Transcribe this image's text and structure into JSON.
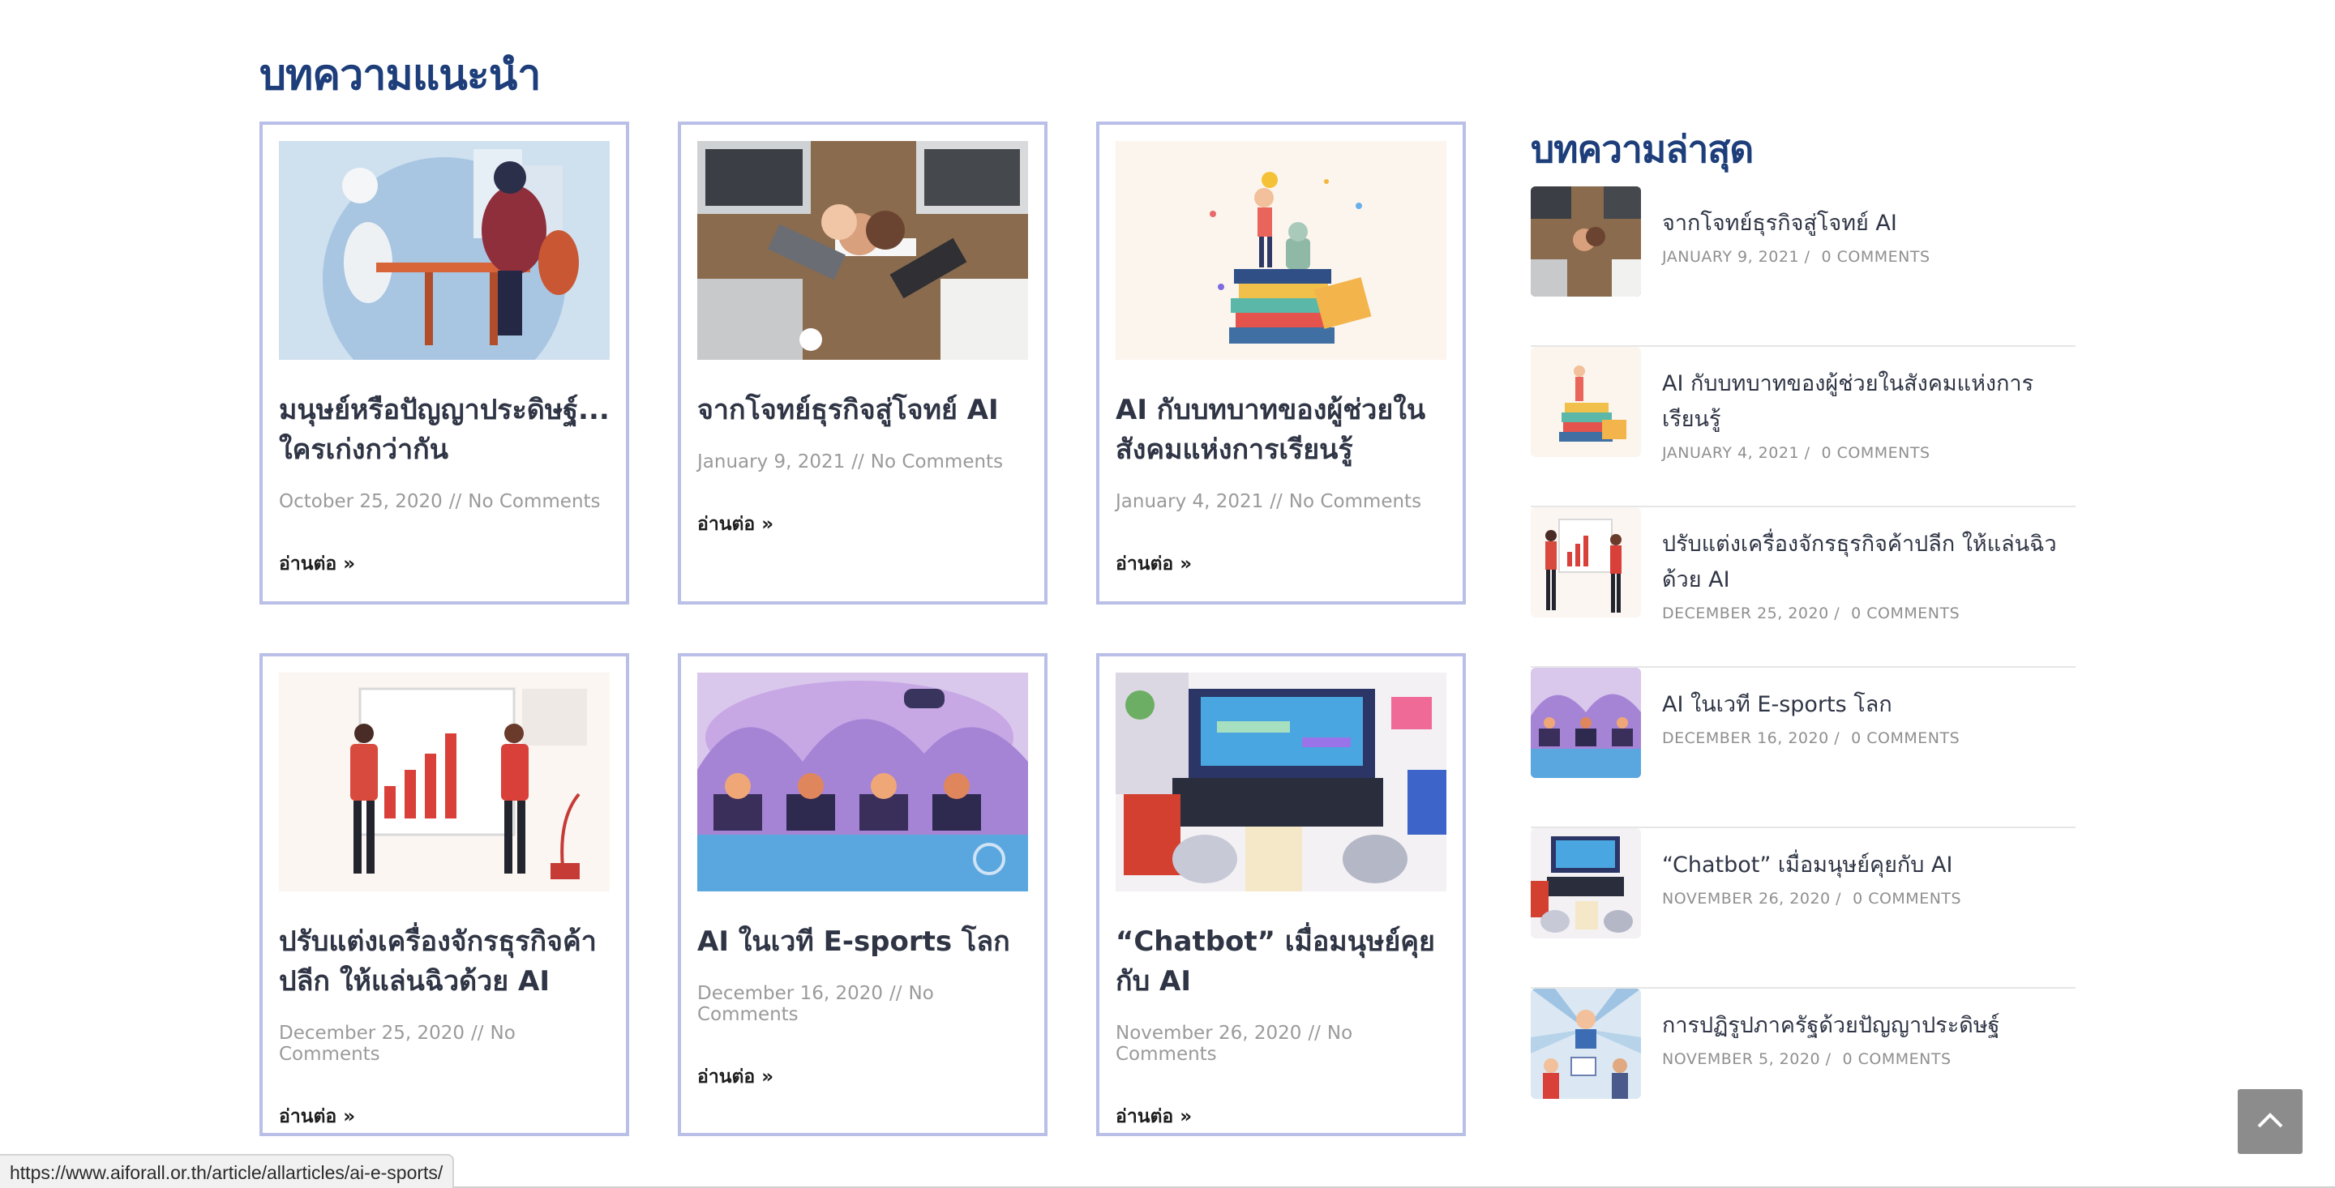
{
  "recommended": {
    "title": "บทความแนะนำ",
    "more_label": "อ่านต่อ »",
    "cards": [
      {
        "title": "มนุษย์หรือปัญญาประดิษฐ์... ใครเก่งกว่ากัน",
        "date": "October 25, 2020",
        "comments": "No Comments",
        "image": "human-vs-robot-illustration"
      },
      {
        "title": "จากโจทย์ธุรกิจสู่โจทย์ AI",
        "date": "January 9, 2021",
        "comments": "No Comments",
        "image": "team-fist-bump-photo"
      },
      {
        "title": "AI กับบทบาทของผู้ช่วยในสังคมแห่งการเรียนรู้",
        "date": "January 4, 2021",
        "comments": "No Comments",
        "image": "books-trophy-illustration"
      },
      {
        "title": "ปรับแต่งเครื่องจักรธุรกิจค้าปลีก ให้แล่นฉิวด้วย AI",
        "date": "December 25, 2020",
        "comments": "No Comments",
        "image": "business-chart-illustration"
      },
      {
        "title": "AI ในเวที E-sports โลก",
        "date": "December 16, 2020",
        "comments": "No Comments",
        "image": "esports-gamers-illustration"
      },
      {
        "title": "“Chatbot” เมื่อมนุษย์คุยกับ AI",
        "date": "November 26, 2020",
        "comments": "No Comments",
        "image": "robot-keyboard-illustration"
      }
    ],
    "separator": "//"
  },
  "latest": {
    "title": "บทความล่าสุด",
    "items": [
      {
        "title": "จากโจทย์ธุรกิจสู่โจทย์ AI",
        "date": "JANUARY 9, 2021 /",
        "comments": "0 COMMENTS",
        "image": "team-fist-bump-photo"
      },
      {
        "title": "AI กับบทบาทของผู้ช่วยในสังคมแห่งการเรียนรู้",
        "date": "JANUARY 4, 2021 /",
        "comments": "0 COMMENTS",
        "image": "books-trophy-illustration"
      },
      {
        "title": "ปรับแต่งเครื่องจักรธุรกิจค้าปลีก ให้แล่นฉิวด้วย AI",
        "date": "DECEMBER 25, 2020 /",
        "comments": "0 COMMENTS",
        "image": "business-chart-illustration"
      },
      {
        "title": "AI ในเวที E-sports โลก",
        "date": "DECEMBER 16, 2020 /",
        "comments": "0 COMMENTS",
        "image": "esports-gamers-illustration"
      },
      {
        "title": "“Chatbot” เมื่อมนุษย์คุยกับ AI",
        "date": "NOVEMBER 26, 2020 /",
        "comments": "0 COMMENTS",
        "image": "robot-keyboard-illustration"
      },
      {
        "title": "การปฏิรูปภาครัฐด้วยปัญญาประดิษฐ์",
        "date": "NOVEMBER 5, 2020 /",
        "comments": "0 COMMENTS",
        "image": "government-people-illustration"
      }
    ]
  },
  "status_bar": {
    "url": "https://www.aiforall.or.th/article/allarticles/ai-e-sports/"
  },
  "scroll_top": {
    "icon": "chevron-up-icon"
  },
  "colors": {
    "heading": "#1d3e7a",
    "card_border": "#b9bfe6",
    "meta": "#9a9a9a",
    "scroll_top_bg": "#8c8c8c"
  }
}
